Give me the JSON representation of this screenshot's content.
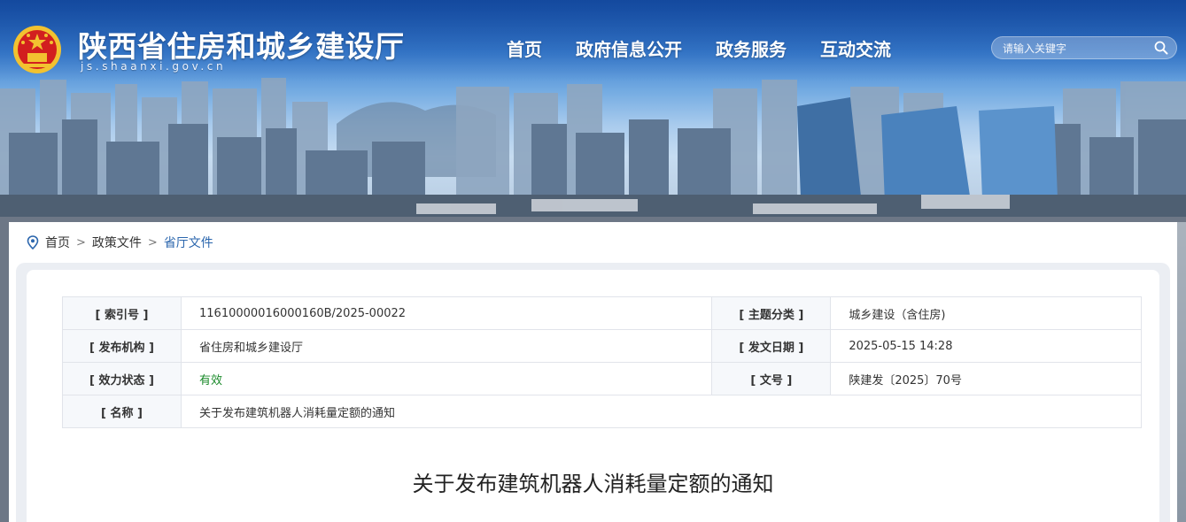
{
  "header": {
    "site_title": "陕西省住房和城乡建设厅",
    "site_domain": "js.shaanxi.gov.cn",
    "nav": [
      "首页",
      "政府信息公开",
      "政务服务",
      "互动交流"
    ],
    "search_placeholder": "请输入关键字"
  },
  "breadcrumb": {
    "items": [
      "首页",
      "政策文件",
      "省厅文件"
    ],
    "separator": ">"
  },
  "meta": {
    "index_label": "[ 索引号 ]",
    "index_value": "11610000016000160B/2025-00022",
    "topic_label": "[ 主题分类 ]",
    "topic_value": "城乡建设（含住房)",
    "publisher_label": "[ 发布机构 ]",
    "publisher_value": "省住房和城乡建设厅",
    "date_label": "[ 发文日期 ]",
    "date_value": "2025-05-15 14:28",
    "status_label": "[ 效力状态 ]",
    "status_value": "有效",
    "docno_label": "[ 文号 ]",
    "docno_value": "陕建发〔2025〕70号",
    "name_label": "[ 名称 ]",
    "name_value": "关于发布建筑机器人消耗量定额的通知"
  },
  "document": {
    "title": "关于发布建筑机器人消耗量定额的通知"
  },
  "colors": {
    "link_blue": "#2b66ad",
    "status_green": "#1a8a2a",
    "emblem_red": "#d21f1f",
    "emblem_gold": "#f2c230"
  }
}
